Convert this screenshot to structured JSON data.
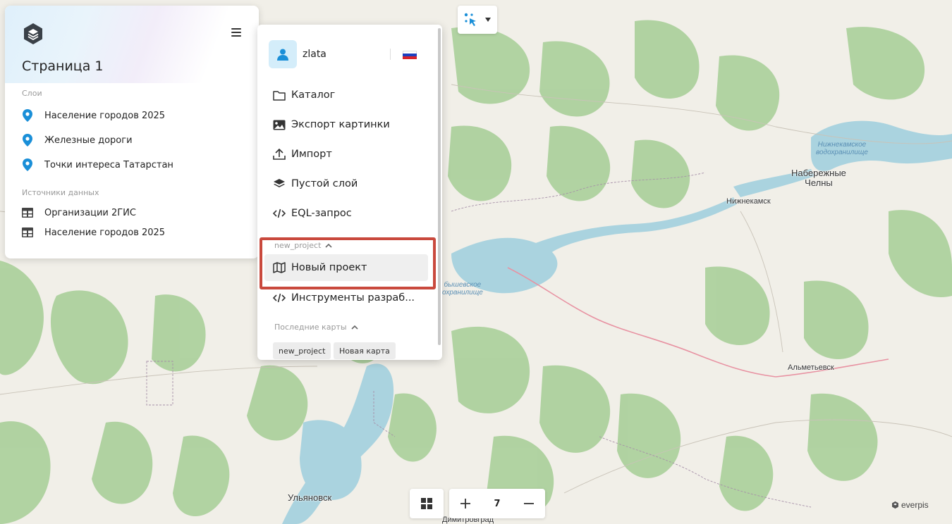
{
  "left_panel": {
    "title": "Страница 1",
    "layers_label": "Слои",
    "layers": [
      {
        "label": "Население городов 2025",
        "icon": "map-pin-icon"
      },
      {
        "label": "Железные дороги",
        "icon": "map-pin-icon"
      },
      {
        "label": "Точки интереса Татарстан",
        "icon": "map-pin-icon"
      }
    ],
    "sources_label": "Источники данных",
    "sources": [
      {
        "label": "Организации 2ГИС",
        "icon": "table-icon"
      },
      {
        "label": "Население городов 2025",
        "icon": "table-icon"
      }
    ]
  },
  "menu": {
    "username": "zlata",
    "items": [
      {
        "label": "Каталог",
        "icon": "folder-icon"
      },
      {
        "label": "Экспорт картинки",
        "icon": "image-icon"
      },
      {
        "label": "Импорт",
        "icon": "upload-icon"
      },
      {
        "label": "Пустой слой",
        "icon": "layers-icon"
      },
      {
        "label": "EQL-запрос",
        "icon": "code-icon"
      }
    ],
    "project_group": "new_project",
    "project_item": "Новый проект",
    "dev_tools": "Инструменты разраб...",
    "recent_label": "Последние карты",
    "recent_maps": [
      "new_project",
      "Новая карта"
    ]
  },
  "map": {
    "zoom": "7",
    "attribution": "everpis",
    "labels": {
      "naberezhnye": "Набережные\nЧелны",
      "nizhnekamsk": "Нижнекамск",
      "almetyevsk": "Альметьевск",
      "ulyanovsk": "Ульяновск",
      "dimitrovgrad": "Димитровград",
      "reservoir1": "Нижнекамское\nводохранилище",
      "reservoir2": "бышевское\nохранилище"
    }
  },
  "colors": {
    "accent": "#1a8fd8",
    "highlight_border": "#c9493d",
    "water": "#aad3df",
    "forest": "#add19e",
    "land": "#f1efe8"
  }
}
